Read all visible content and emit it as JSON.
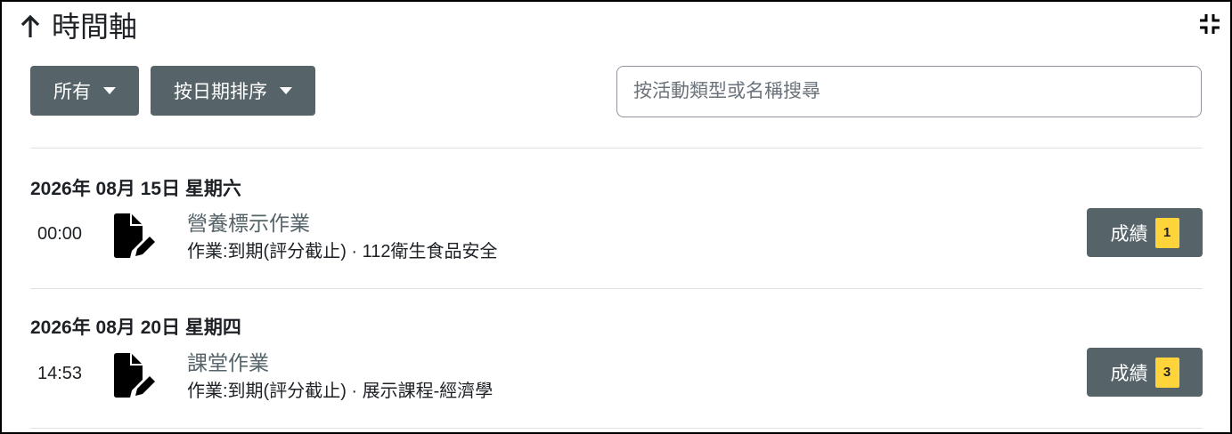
{
  "header": {
    "title": "時間軸"
  },
  "toolbar": {
    "filter_label": "所有",
    "sort_label": "按日期排序"
  },
  "search": {
    "placeholder": "按活動類型或名稱搜尋"
  },
  "groups": [
    {
      "date": "2026年 08月 15日 星期六",
      "event": {
        "time": "00:00",
        "name": "營養標示作業",
        "meta": "作業:到期(評分截止) · 112衛生食品安全",
        "action_label": "成績",
        "badge": "1"
      }
    },
    {
      "date": "2026年 08月 20日 星期四",
      "event": {
        "time": "14:53",
        "name": "課堂作業",
        "meta": "作業:到期(評分截止) · 展示課程-經濟學",
        "action_label": "成績",
        "badge": "3"
      }
    }
  ],
  "icons": {
    "title": "arrow-up-icon",
    "collapse": "collapse-icon",
    "event": "file-edit-icon"
  },
  "colors": {
    "button_bg": "#56646a",
    "badge_bg": "#ffd43b",
    "divider": "#dee2e6"
  }
}
